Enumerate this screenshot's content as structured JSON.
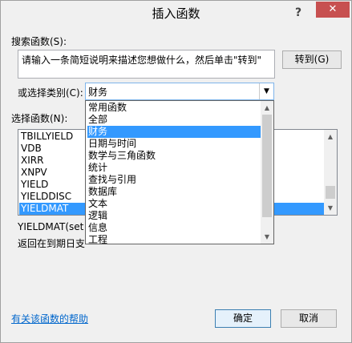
{
  "window": {
    "title": "插入函数",
    "help_glyph": "?",
    "close_glyph": "✕"
  },
  "search": {
    "label": "搜索函数(S):",
    "value": "请输入一条简短说明来描述您想做什么，然后单击\"转到\"",
    "go_button": "转到(G)"
  },
  "category": {
    "label": "或选择类别(C):",
    "value": "财务",
    "arrow_glyph": "▼",
    "options": [
      "常用函数",
      "全部",
      "财务",
      "日期与时间",
      "数学与三角函数",
      "统计",
      "查找与引用",
      "数据库",
      "文本",
      "逻辑",
      "信息",
      "工程"
    ],
    "selected_index": 2
  },
  "functions": {
    "label": "选择函数(N):",
    "items": [
      "TBILLYIELD",
      "VDB",
      "XIRR",
      "XNPV",
      "YIELD",
      "YIELDDISC",
      "YIELDMAT"
    ],
    "selected_index": 6
  },
  "description": {
    "signature": "YIELDMAT(set",
    "text": "返回在到期日支"
  },
  "footer": {
    "help_link": "有关该函数的帮助",
    "ok_button": "确定",
    "cancel_button": "取消"
  }
}
